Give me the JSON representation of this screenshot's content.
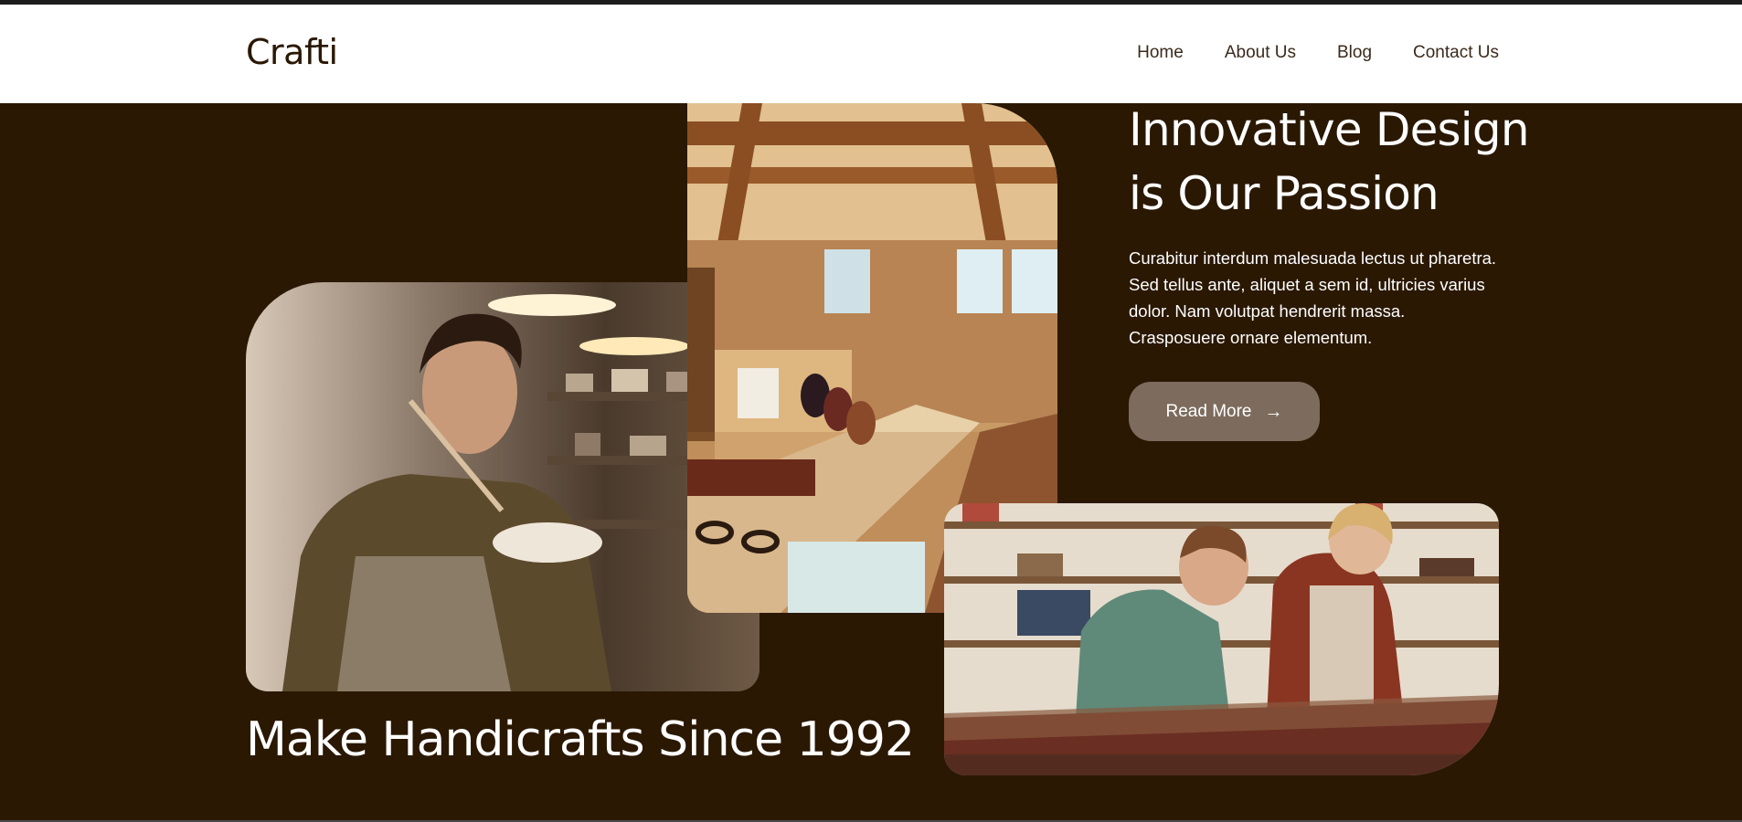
{
  "header": {
    "logo": "Crafti",
    "nav": [
      {
        "label": "Home"
      },
      {
        "label": "About Us"
      },
      {
        "label": "Blog"
      },
      {
        "label": "Contact Us"
      }
    ]
  },
  "hero": {
    "title": "Innovative Design is Our Passion",
    "body": "Curabitur interdum malesuada lectus ut pharetra. Sed tellus ante, aliquet a sem id, ultricies varius dolor. Nam volutpat hendrerit massa. Crasposuere ornare elementum.",
    "button_label": "Read More",
    "button_icon": "arrow-right-icon"
  },
  "tagline": "Make Handicrafts Since 1992",
  "colors": {
    "background": "#2a1803",
    "header": "#ffffff",
    "button": "#7d6c5d",
    "text_light": "#ffffff",
    "text_dark": "#2a1803"
  }
}
